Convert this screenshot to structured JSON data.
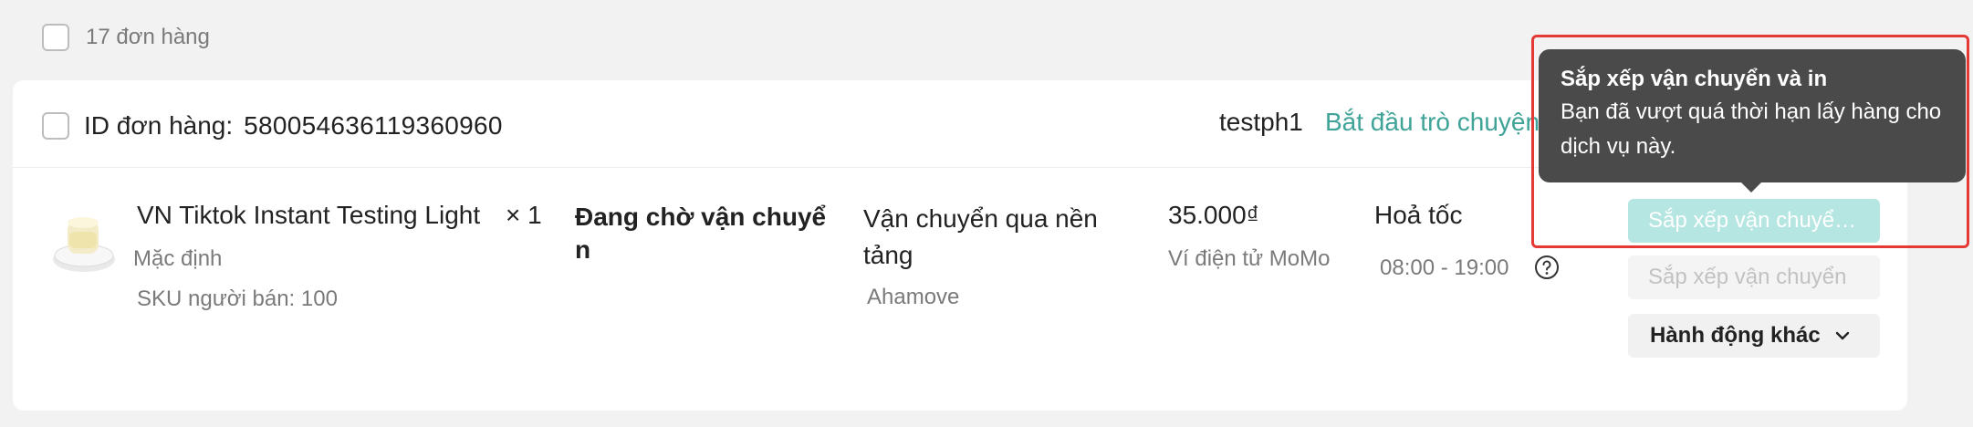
{
  "summary": {
    "order_count_label": "17 đơn hàng"
  },
  "order": {
    "id_label": "ID đơn hàng:",
    "id_value": "580054636119360960",
    "buyer": "testph1",
    "chat_link": "Bắt đầu trò chuyện",
    "product": {
      "name": "VN Tiktok Instant Testing Light",
      "quantity": "× 1",
      "variant": "Mặc định",
      "sku": "SKU người bán: 100"
    },
    "status": "Đang chờ vận chuyển",
    "shipping": {
      "method": "Vận chuyển qua nền tảng",
      "carrier": "Ahamove"
    },
    "price": "35.000₫",
    "payment_method": "Ví điện tử MoMo",
    "delivery": {
      "type": "Hoả tốc",
      "time_window": "08:00 - 19:00"
    },
    "actions": {
      "arrange_and_print": "Sắp xếp vận chuyển và in",
      "arrange": "Sắp xếp vận chuyển",
      "more": "Hành động khác"
    }
  },
  "tooltip": {
    "title": "Sắp xếp vận chuyển và in",
    "body": "Bạn đã vượt quá thời hạn lấy hàng cho dịch vụ này."
  },
  "colors": {
    "accent": "#3fa397",
    "disabled_primary": "#b6e6e1",
    "tooltip_bg": "#4a4a4a",
    "highlight": "#e53935"
  }
}
